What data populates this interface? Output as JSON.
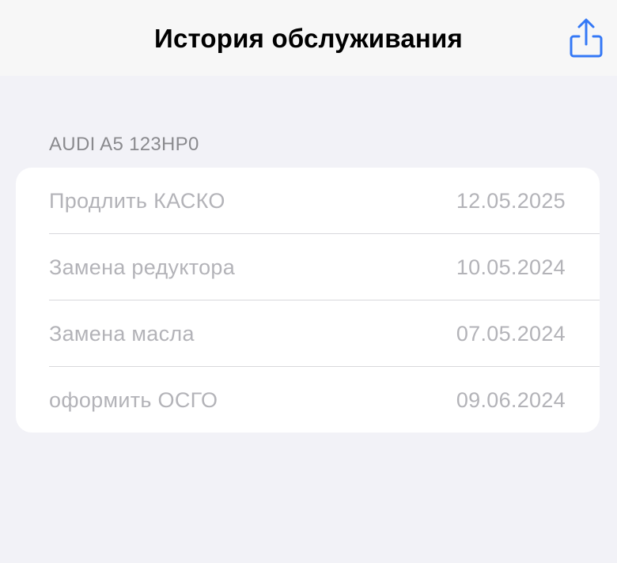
{
  "navbar": {
    "title": "История обслуживания",
    "share_icon": "share-icon",
    "accent_color": "#3478f6"
  },
  "section": {
    "header": "AUDI A5 123HP0"
  },
  "items": [
    {
      "title": "Продлить КАСКО",
      "date": "12.05.2025"
    },
    {
      "title": "Замена редуктора",
      "date": "10.05.2024"
    },
    {
      "title": "Замена масла",
      "date": "07.05.2024"
    },
    {
      "title": "оформить ОСГО",
      "date": "09.06.2024"
    }
  ]
}
